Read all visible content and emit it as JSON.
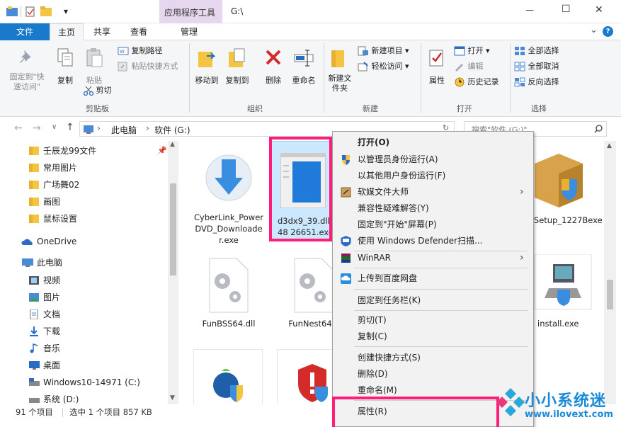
{
  "titlebar": {
    "context_tab": "应用程序工具",
    "path": "G:\\",
    "qat_dropdown": "▾",
    "min": "—",
    "max": "☐",
    "close": "✕"
  },
  "tabs": {
    "file": "文件",
    "home": "主页",
    "share": "共享",
    "view": "查看",
    "manage": "管理",
    "chevron": "⌄",
    "help": "?"
  },
  "ribbon": {
    "clipboard": {
      "pin": "固定到\"快速访问\"",
      "copy": "复制",
      "paste": "粘贴",
      "copy_path": "复制路径",
      "paste_shortcut": "粘贴快捷方式",
      "cut": "剪切",
      "label": "剪贴板"
    },
    "organize": {
      "move_to": "移动到",
      "copy_to": "复制到",
      "delete": "删除",
      "rename": "重命名",
      "label": "组织"
    },
    "new": {
      "new_folder": "新建文件夹",
      "new_item": "新建项目",
      "easy_access": "轻松访问",
      "label": "新建"
    },
    "open": {
      "properties": "属性",
      "open": "打开",
      "edit": "编辑",
      "history": "历史记录",
      "label": "打开"
    },
    "select": {
      "select_all": "全部选择",
      "select_none": "全部取消",
      "invert": "反向选择",
      "label": "选择"
    }
  },
  "address": {
    "breadcrumb_1": "此电脑",
    "breadcrumb_2": "软件 (G:)",
    "search_placeholder": "搜索\"软件 (G:)\""
  },
  "nav": {
    "quick": [
      "壬辰龙99文件",
      "常用图片",
      "广场舞02",
      "画图",
      "鼠标设置"
    ],
    "onedrive": "OneDrive",
    "thispc": "此电脑",
    "pc_items": [
      "视频",
      "图片",
      "文档",
      "下载",
      "音乐",
      "桌面",
      "Windows10-14971 (C:)",
      "系统 (D:)"
    ]
  },
  "files": {
    "cyberlink": "CyberLink_PowerDVD_Downloader.exe",
    "d3dx9": "d3dx9_39.dll-48 26651.exe",
    "gsetup": "GSetup_1227Bexe",
    "funbss": "FunBSS64.dll",
    "funnest": "FunNest64.c",
    "install": "install.exe"
  },
  "context_menu": {
    "open": "打开(O)",
    "run_admin": "以管理员身份运行(A)",
    "run_other": "以其他用户身份运行(F)",
    "soft_master": "软媒文件大师",
    "compat": "兼容性疑难解答(Y)",
    "pin_start": "固定到\"开始\"屏幕(P)",
    "defender": "使用 Windows Defender扫描...",
    "winrar": "WinRAR",
    "baidu": "上传到百度网盘",
    "pin_taskbar": "固定到任务栏(K)",
    "cut": "剪切(T)",
    "copy": "复制(C)",
    "create_shortcut": "创建快捷方式(S)",
    "delete": "删除(D)",
    "rename": "重命名(M)",
    "properties": "属性(R)"
  },
  "status": {
    "count": "91 个项目",
    "selected": "选中 1 个项目  857 KB"
  },
  "watermark": {
    "cn": "小小系统迷",
    "url": "www.ilovext.com"
  },
  "colors": {
    "accent": "#1979ca",
    "highlight": "#ff1d7a",
    "context_tab_bg": "#e6d7ee",
    "selection": "#cce8ff"
  }
}
